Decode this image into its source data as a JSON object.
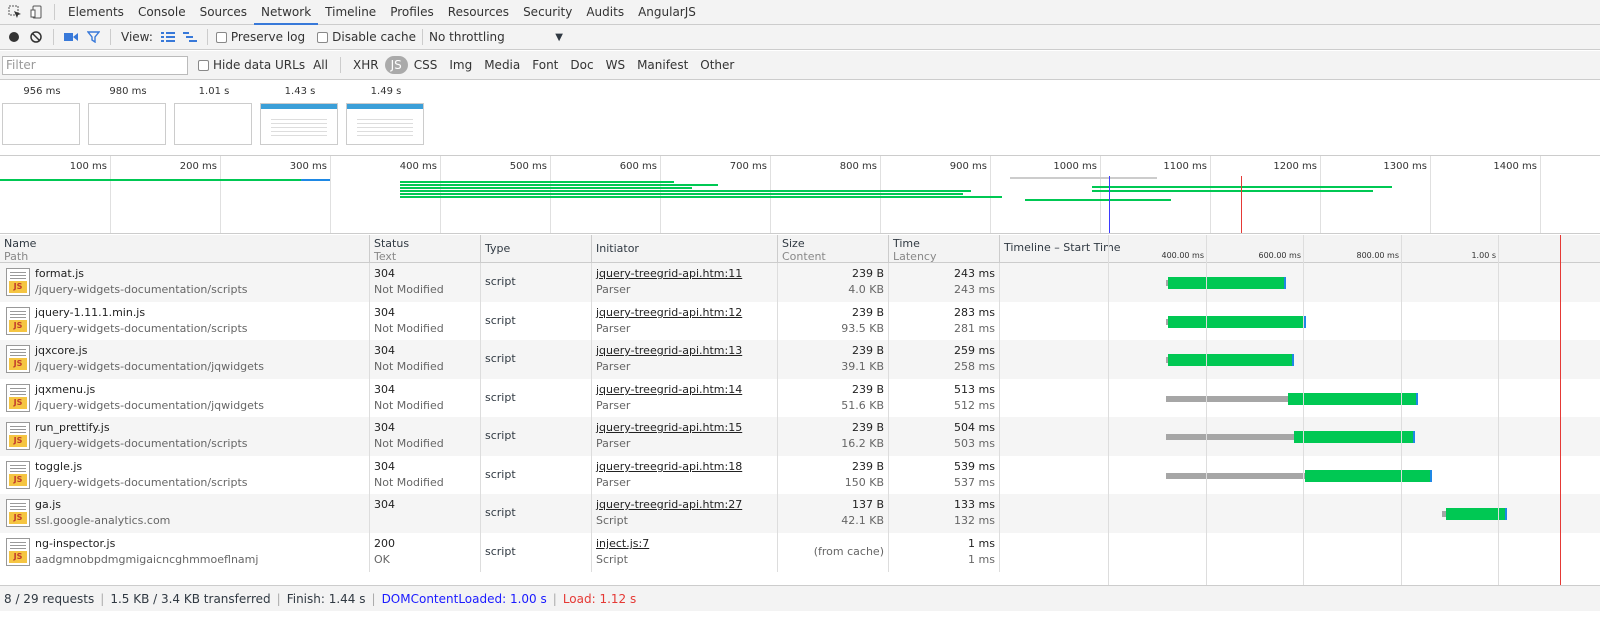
{
  "tabs": [
    "Elements",
    "Console",
    "Sources",
    "Network",
    "Timeline",
    "Profiles",
    "Resources",
    "Security",
    "Audits",
    "AngularJS"
  ],
  "active_tab": "Network",
  "toolbar": {
    "view_label": "View:",
    "preserve_log": "Preserve log",
    "disable_cache": "Disable cache",
    "throttling": "No throttling"
  },
  "filterbar": {
    "placeholder": "Filter",
    "hide_data_urls": "Hide data URLs",
    "types": [
      "All",
      "XHR",
      "JS",
      "CSS",
      "Img",
      "Media",
      "Font",
      "Doc",
      "WS",
      "Manifest",
      "Other"
    ],
    "active_type": "JS"
  },
  "filmstrip": [
    "956 ms",
    "980 ms",
    "1.01 s",
    "1.43 s",
    "1.49 s"
  ],
  "overview_ticks": [
    "100 ms",
    "200 ms",
    "300 ms",
    "400 ms",
    "500 ms",
    "600 ms",
    "700 ms",
    "800 ms",
    "900 ms",
    "1000 ms",
    "1100 ms",
    "1200 ms",
    "1300 ms",
    "1400 ms"
  ],
  "columns": {
    "name": "Name",
    "name_sub": "Path",
    "status": "Status",
    "status_sub": "Text",
    "type": "Type",
    "initiator": "Initiator",
    "size": "Size",
    "size_sub": "Content",
    "time": "Time",
    "time_sub": "Latency",
    "timeline": "Timeline – Start Time",
    "timeline_ticks": [
      "400.00 ms",
      "600.00 ms",
      "800.00 ms",
      "1.00 s"
    ]
  },
  "requests": [
    {
      "name": "format.js",
      "path": "/jquery-widgets-documentation/scripts",
      "status": "304",
      "status_text": "Not Modified",
      "type": "script",
      "initiator": "jquery-treegrid-api.htm:11",
      "initiator_type": "Parser",
      "size": "239 B",
      "content": "4.0 KB",
      "time": "243 ms",
      "latency": "243 ms"
    },
    {
      "name": "jquery-1.11.1.min.js",
      "path": "/jquery-widgets-documentation/scripts",
      "status": "304",
      "status_text": "Not Modified",
      "type": "script",
      "initiator": "jquery-treegrid-api.htm:12",
      "initiator_type": "Parser",
      "size": "239 B",
      "content": "93.5 KB",
      "time": "283 ms",
      "latency": "281 ms"
    },
    {
      "name": "jqxcore.js",
      "path": "/jquery-widgets-documentation/jqwidgets",
      "status": "304",
      "status_text": "Not Modified",
      "type": "script",
      "initiator": "jquery-treegrid-api.htm:13",
      "initiator_type": "Parser",
      "size": "239 B",
      "content": "39.1 KB",
      "time": "259 ms",
      "latency": "258 ms"
    },
    {
      "name": "jqxmenu.js",
      "path": "/jquery-widgets-documentation/jqwidgets",
      "status": "304",
      "status_text": "Not Modified",
      "type": "script",
      "initiator": "jquery-treegrid-api.htm:14",
      "initiator_type": "Parser",
      "size": "239 B",
      "content": "51.6 KB",
      "time": "513 ms",
      "latency": "512 ms"
    },
    {
      "name": "run_prettify.js",
      "path": "/jquery-widgets-documentation/scripts",
      "status": "304",
      "status_text": "Not Modified",
      "type": "script",
      "initiator": "jquery-treegrid-api.htm:15",
      "initiator_type": "Parser",
      "size": "239 B",
      "content": "16.2 KB",
      "time": "504 ms",
      "latency": "503 ms"
    },
    {
      "name": "toggle.js",
      "path": "/jquery-widgets-documentation/scripts",
      "status": "304",
      "status_text": "Not Modified",
      "type": "script",
      "initiator": "jquery-treegrid-api.htm:18",
      "initiator_type": "Parser",
      "size": "239 B",
      "content": "150 KB",
      "time": "539 ms",
      "latency": "537 ms"
    },
    {
      "name": "ga.js",
      "path": "ssl.google-analytics.com",
      "status": "304",
      "status_text": "",
      "type": "script",
      "initiator": "jquery-treegrid-api.htm:27",
      "initiator_type": "Script",
      "size": "137 B",
      "content": "42.1 KB",
      "time": "133 ms",
      "latency": "132 ms"
    },
    {
      "name": "ng-inspector.js",
      "path": "aadgmnobpdmgmigaicncghmmoeflnamj",
      "status": "200",
      "status_text": "OK",
      "type": "script",
      "initiator": "inject.js:7",
      "initiator_type": "Script",
      "size": "(from cache)",
      "content": "",
      "time": "1 ms",
      "latency": "1 ms"
    }
  ],
  "waterfall_ms": [
    {
      "queue_start": 318,
      "download_start": 324,
      "end": 567
    },
    {
      "queue_start": 318,
      "download_start": 324,
      "end": 607
    },
    {
      "queue_start": 318,
      "download_start": 324,
      "end": 583
    },
    {
      "queue_start": 318,
      "download_start": 570,
      "end": 837
    },
    {
      "queue_start": 318,
      "download_start": 581,
      "end": 830
    },
    {
      "queue_start": 318,
      "download_start": 604,
      "end": 865
    },
    {
      "queue_start": 886,
      "download_start": 894,
      "end": 1019
    },
    {
      "queue_start": 0,
      "download_start": 0,
      "end": 0
    }
  ],
  "status": {
    "requests": "8 / 29 requests",
    "transferred": "1.5 KB / 3.4 KB transferred",
    "finish": "Finish: 1.44 s",
    "dcl": "DOMContentLoaded: 1.00 s",
    "load": "Load: 1.12 s"
  },
  "colors": {
    "accent": "#3879d9",
    "download": "#00c853",
    "wait": "#a6a6a6",
    "dcl": "#1a1aff",
    "load": "#e53935"
  }
}
